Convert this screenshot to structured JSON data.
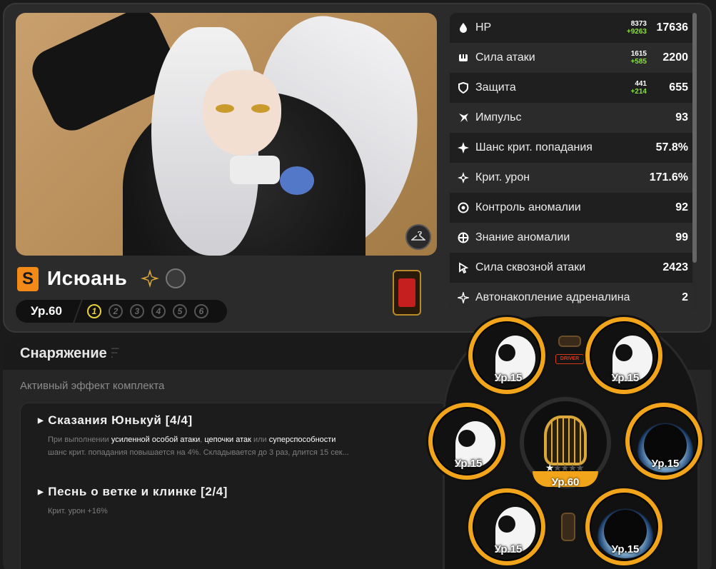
{
  "character": {
    "name": "Исюань",
    "rank": "S",
    "level": "Ур.60",
    "mindscapes": [
      "1",
      "2",
      "3",
      "4",
      "5",
      "6"
    ],
    "active_mindscapes": 1
  },
  "stats": [
    {
      "icon": "hp-icon",
      "label": "HP",
      "base": "8373",
      "add": "+9263",
      "total": "17636"
    },
    {
      "icon": "attack-icon",
      "label": "Сила атаки",
      "base": "1615",
      "add": "+585",
      "total": "2200"
    },
    {
      "icon": "defense-icon",
      "label": "Защита",
      "base": "441",
      "add": "+214",
      "total": "655"
    },
    {
      "icon": "impact-icon",
      "label": "Импульс",
      "base": "",
      "add": "",
      "total": "93"
    },
    {
      "icon": "crit-rate-icon",
      "label": "Шанс крит. попадания",
      "base": "",
      "add": "",
      "total": "57.8%"
    },
    {
      "icon": "crit-dmg-icon",
      "label": "Крит. урон",
      "base": "",
      "add": "",
      "total": "171.6%"
    },
    {
      "icon": "anomaly-mastery-icon",
      "label": "Контроль аномалии",
      "base": "",
      "add": "",
      "total": "92"
    },
    {
      "icon": "anomaly-proficiency-icon",
      "label": "Знание аномалии",
      "base": "",
      "add": "",
      "total": "99"
    },
    {
      "icon": "sheer-force-icon",
      "label": "Сила сквозной атаки",
      "base": "",
      "add": "",
      "total": "2423"
    },
    {
      "icon": "adrenaline-icon",
      "label": "Автонакопление адреналина",
      "base": "",
      "add": "",
      "total": "2"
    }
  ],
  "equipment": {
    "title": "Снаряжение",
    "set_caption": "Активный эффект комплекта",
    "sets": [
      {
        "name": "Сказания Юнькуй [4/4]",
        "desc": [
          {
            "t": "При выполнении ",
            "hl": false
          },
          {
            "t": "усиленной особой атаки",
            "hl": true
          },
          {
            "t": ", ",
            "hl": false
          },
          {
            "t": "цепочки атак",
            "hl": true
          },
          {
            "t": " или ",
            "hl": false
          },
          {
            "t": "суперспособности",
            "hl": true
          }
        ],
        "desc2": "шанс крит. попадания повышается на 4%. Складывается до 3 раз, длится 15 сек..."
      },
      {
        "name": "Песнь о ветке и клинке [2/4]",
        "desc2": "Крит. урон +16%"
      }
    ]
  },
  "discs": {
    "driver_label": "DRIVER",
    "slots": [
      {
        "type": "yinyang",
        "level": "Ур.15"
      },
      {
        "type": "yinyang",
        "level": "Ур.15"
      },
      {
        "type": "yinyang",
        "level": "Ур.15"
      },
      {
        "type": "cat",
        "level": "Ур.15"
      },
      {
        "type": "yinyang",
        "level": "Ур.15"
      },
      {
        "type": "cat",
        "level": "Ур.15"
      }
    ],
    "engine_level": "Ур.60",
    "engine_stars": 1,
    "engine_stars_max": 5
  },
  "colors": {
    "accent": "#f2a51a",
    "rank": "#f28a1a",
    "stat_bonus": "#88e040",
    "mind_active": "#e8d23c"
  }
}
